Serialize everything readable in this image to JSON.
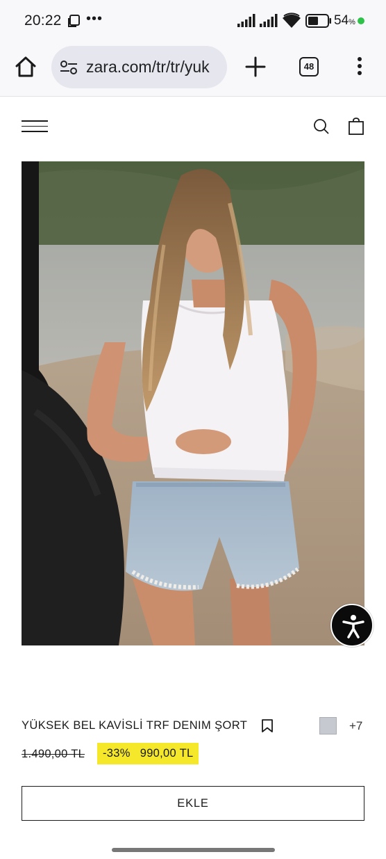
{
  "status_bar": {
    "time": "20:22",
    "battery_text": "54",
    "battery_unit": "%",
    "battery_level": 0.54,
    "notification_dot_color": "#2ec24a",
    "icons": [
      "notification-icon",
      "more-dots-icon",
      "signal-icon",
      "signal-icon",
      "wifi-icon",
      "battery-icon"
    ]
  },
  "browser": {
    "url": "zara.com/tr/tr/yuk",
    "tab_count": "48",
    "icons": [
      "home-icon",
      "site-settings-icon",
      "plus-icon",
      "tab-switcher-icon",
      "more-vert-icon"
    ]
  },
  "site_header": {
    "icons": [
      "hamburger-menu-icon",
      "search-icon",
      "shopping-bag-icon"
    ]
  },
  "product": {
    "image_icon": "product-photo",
    "name": "YÜKSEK BEL KAVİSLİ TRF DENIM ŞORT",
    "color_swatch": "#c6c9cf",
    "more_colors": "+7",
    "old_price": "1.490,00 TL",
    "discount": "-33%",
    "new_price": "990,00 TL",
    "highlight_color": "#f5e82a",
    "add_label": "EKLE"
  },
  "accessibility": {
    "icon": "accessibility-icon"
  }
}
